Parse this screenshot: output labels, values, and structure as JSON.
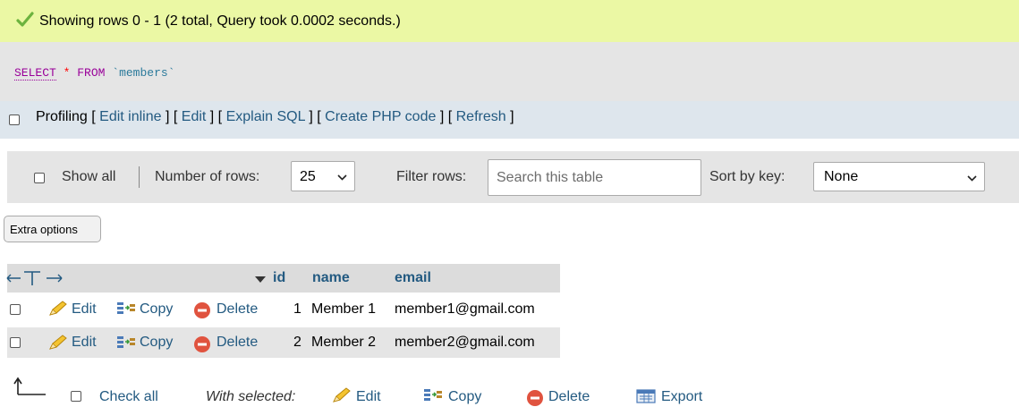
{
  "success": {
    "message": "Showing rows 0 - 1 (2 total, Query took 0.0002 seconds.)"
  },
  "sql": {
    "select": "SELECT",
    "star": "*",
    "from": "FROM",
    "table": "`members`"
  },
  "profiling": {
    "label": "Profiling",
    "links": [
      "Edit inline",
      "Edit",
      "Explain SQL",
      "Create PHP code",
      "Refresh"
    ]
  },
  "navbar": {
    "show_all": "Show all",
    "num_rows_label": "Number of rows:",
    "num_rows_value": "25",
    "filter_label": "Filter rows:",
    "filter_placeholder": "Search this table",
    "sort_label": "Sort by key:",
    "sort_value": "None"
  },
  "extra_options": "Extra options",
  "table": {
    "columns": [
      "id",
      "name",
      "email"
    ],
    "actions": {
      "edit": "Edit",
      "copy": "Copy",
      "delete": "Delete"
    },
    "rows": [
      {
        "id": "1",
        "name": "Member 1",
        "email": "member1@gmail.com"
      },
      {
        "id": "2",
        "name": "Member 2",
        "email": "member2@gmail.com"
      }
    ]
  },
  "footer": {
    "check_all": "Check all",
    "with_selected": "With selected:",
    "edit": "Edit",
    "copy": "Copy",
    "delete": "Delete",
    "export": "Export"
  },
  "colors": {
    "success_bg": "#ebf8a4",
    "link": "#235a81",
    "header_bg": "#dcdcdc",
    "row_alt": "#e5e5e5"
  }
}
